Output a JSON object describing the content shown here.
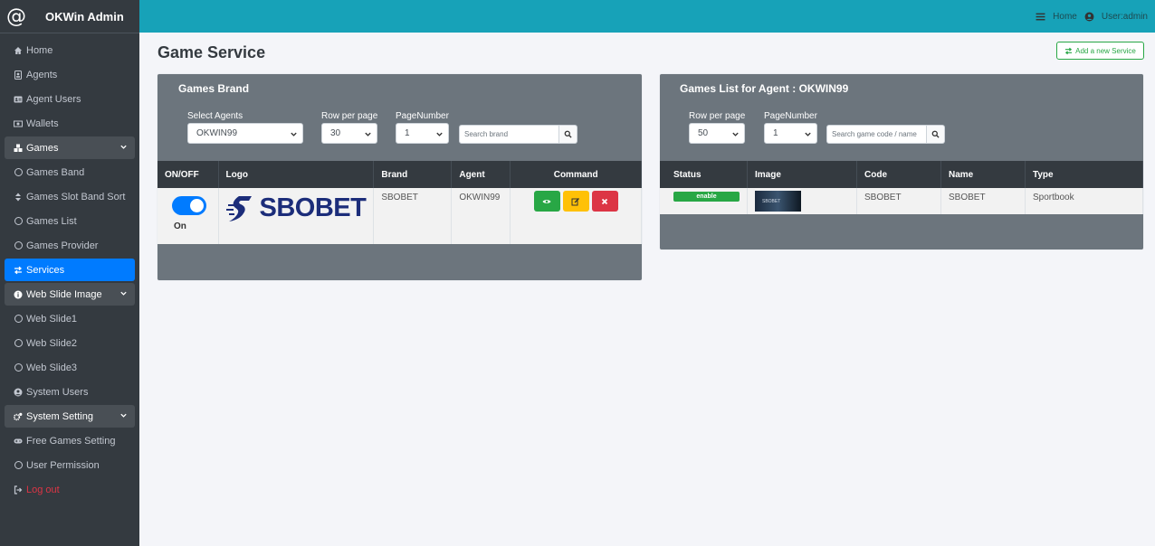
{
  "app": {
    "brand_icon": "@",
    "title": "OKWin Admin"
  },
  "colors": {
    "sidebar": "#343a40",
    "topbar": "#17a2b8",
    "active": "#007bff",
    "success": "#28a745",
    "warning": "#ffc107",
    "danger": "#dc3545",
    "card": "#6c757d"
  },
  "sidebar": {
    "items": [
      {
        "label": "Home",
        "icon": "home-icon"
      },
      {
        "label": "Agents",
        "icon": "id-badge-icon"
      },
      {
        "label": "Agent Users",
        "icon": "address-card-icon"
      },
      {
        "label": "Wallets",
        "icon": "money-bill-icon"
      },
      {
        "label": "Games",
        "icon": "cubes-icon"
      },
      {
        "label": "Games Band",
        "icon": "circle-icon"
      },
      {
        "label": "Games Slot Band Sort",
        "icon": "sort-icon"
      },
      {
        "label": "Games List",
        "icon": "circle-icon"
      },
      {
        "label": "Games Provider",
        "icon": "circle-icon"
      },
      {
        "label": "Services",
        "icon": "exchange-icon"
      },
      {
        "label": "Web Slide Image",
        "icon": "info-circle-icon"
      },
      {
        "label": "Web Slide1",
        "icon": "circle-icon"
      },
      {
        "label": "Web Slide2",
        "icon": "circle-icon"
      },
      {
        "label": "Web Slide3",
        "icon": "circle-icon"
      },
      {
        "label": "System Users",
        "icon": "user-circle-icon"
      },
      {
        "label": "System Setting",
        "icon": "cogs-icon"
      },
      {
        "label": "Free Games Setting",
        "icon": "gamepad-icon"
      },
      {
        "label": "User Permission",
        "icon": "circle-icon"
      },
      {
        "label": "Log out",
        "icon": "sign-out-icon"
      }
    ]
  },
  "topbar": {
    "home": "Home",
    "user": "User:admin"
  },
  "page": {
    "title": "Game Service",
    "add_button": "Add a new Service"
  },
  "brand_panel": {
    "title": "Games Brand",
    "filters": {
      "agent_label": "Select Agents",
      "agent_value": "OKWIN99",
      "rows_label": "Row per page",
      "rows_value": "30",
      "page_label": "PageNumber",
      "page_value": "1",
      "search_placeholder": "Search brand"
    },
    "columns": [
      "ON/OFF",
      "Logo",
      "Brand",
      "Agent",
      "Command"
    ],
    "rows": [
      {
        "status": "On",
        "logo_text": "SBOBET",
        "brand": "SBOBET",
        "agent": "OKWIN99"
      }
    ]
  },
  "list_panel": {
    "title": "Games List for Agent : OKWIN99",
    "filters": {
      "rows_label": "Row per page",
      "rows_value": "50",
      "page_label": "PageNumber",
      "page_value": "1",
      "search_placeholder": "Search game code / name"
    },
    "columns": [
      "Status",
      "Image",
      "Code",
      "Name",
      "Type"
    ],
    "rows": [
      {
        "status": "enable",
        "thumb_text": "SBOBET",
        "code": "SBOBET",
        "name": "SBOBET",
        "type": "Sportbook"
      }
    ]
  }
}
